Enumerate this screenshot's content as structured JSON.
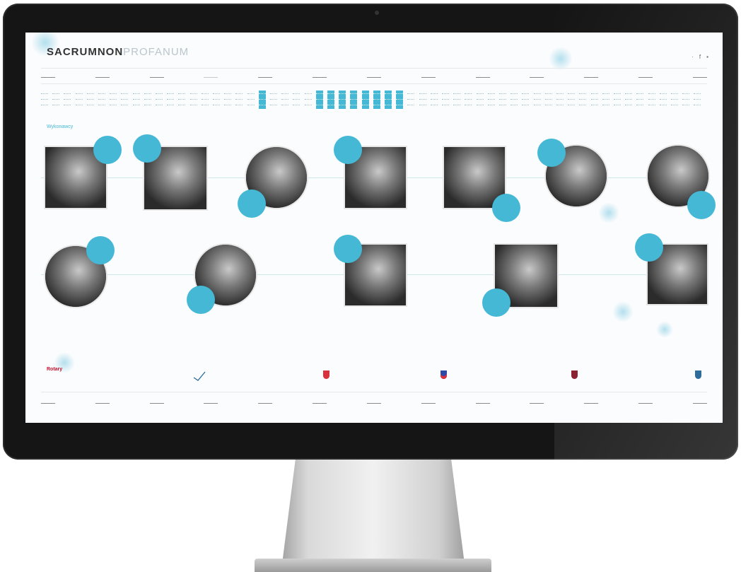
{
  "site": {
    "logo_bold": "SACRUMNON",
    "logo_light": "PROFANUM"
  },
  "social": [
    "·",
    "f",
    "▪"
  ],
  "nav_top": [
    "",
    "",
    "",
    "",
    "",
    "",
    "",
    "",
    "",
    "",
    "",
    "",
    ""
  ],
  "nav_bottom": [
    "",
    "",
    "",
    "",
    "",
    "",
    "",
    "",
    "",
    "",
    "",
    "",
    ""
  ],
  "calendar": {
    "day_count": 58,
    "selected_days": [
      19,
      24,
      25,
      26,
      27,
      28,
      29,
      30,
      31
    ]
  },
  "section": {
    "title": "Wykonawcy"
  },
  "performers_row1": [
    {
      "shape": "square",
      "tag": ""
    },
    {
      "shape": "square",
      "tag": ""
    },
    {
      "shape": "round",
      "tag": ""
    },
    {
      "shape": "square",
      "tag": ""
    },
    {
      "shape": "square",
      "tag": ""
    },
    {
      "shape": "round",
      "tag": ""
    },
    {
      "shape": "round",
      "tag": ""
    }
  ],
  "performers_row2": [
    {
      "shape": "round",
      "tag": ""
    },
    {
      "shape": "round",
      "tag": ""
    },
    {
      "shape": "square",
      "tag": ""
    },
    {
      "shape": "square",
      "tag": ""
    },
    {
      "shape": "square",
      "tag": ""
    }
  ],
  "sponsors": {
    "label": "",
    "first_lines": [
      "",
      "Rotary",
      "",
      ""
    ]
  },
  "colors": {
    "accent": "#45b8d6",
    "bezel": "#151515",
    "page_bg": "#fbfcfd"
  }
}
